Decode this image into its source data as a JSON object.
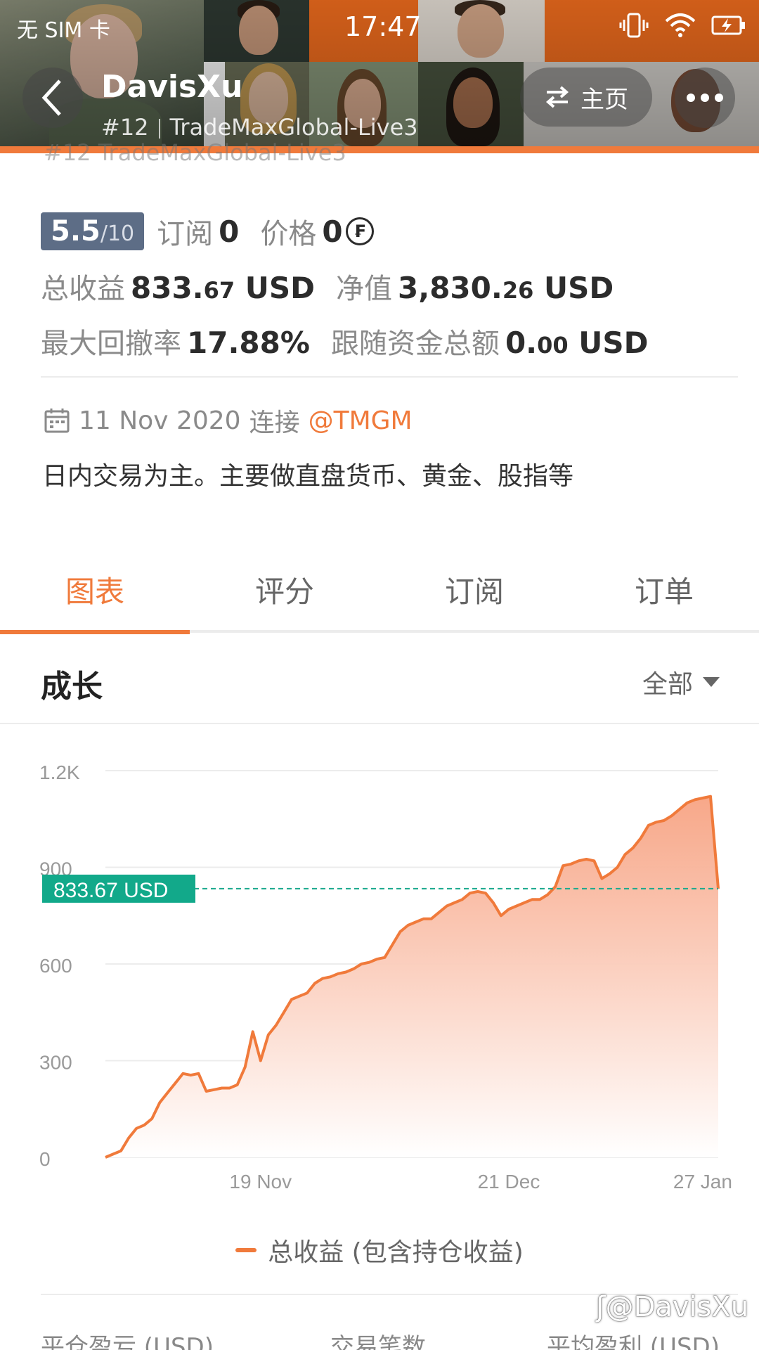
{
  "status_bar": {
    "carrier": "无 SIM 卡",
    "time": "17:47",
    "icons": [
      "vibrate-icon",
      "wifi-icon",
      "battery-charging-icon"
    ]
  },
  "header": {
    "user_name": "DavisXu",
    "rank": "#12",
    "server": "TradeMaxGlobal-Live3",
    "home_label": "主页",
    "ghost_text": "#12  TradeMaxGlobal-Live3"
  },
  "stats": {
    "score": "5.5",
    "score_max": "/10",
    "subscribe_label": "订阅",
    "subscribe_value": "0",
    "price_label": "价格",
    "price_value": "0",
    "total_profit_label": "总收益",
    "total_profit_int": "833.",
    "total_profit_dec": "67",
    "total_profit_unit": " USD",
    "equity_label": "净值",
    "equity_int": "3,830.",
    "equity_dec": "26",
    "equity_unit": " USD",
    "drawdown_label": "最大回撤率",
    "drawdown_value": "17.88%",
    "follow_label": "跟随资金总额",
    "follow_int": "0.",
    "follow_dec": "00",
    "follow_unit": " USD"
  },
  "connect": {
    "date": "11 Nov 2020",
    "text": "连接",
    "broker": "@TMGM"
  },
  "description": "日内交易为主。主要做直盘货币、黄金、股指等",
  "tabs": [
    "图表",
    "评分",
    "订阅",
    "订单"
  ],
  "active_tab": 0,
  "section": {
    "title": "成长",
    "filter": "全部"
  },
  "chart_data": {
    "type": "area",
    "series": [
      {
        "name": "总收益 (包含持仓收益)",
        "points": [
          [
            0,
            0
          ],
          [
            1,
            10
          ],
          [
            2,
            20
          ],
          [
            3,
            60
          ],
          [
            4,
            90
          ],
          [
            5,
            100
          ],
          [
            6,
            120
          ],
          [
            7,
            170
          ],
          [
            8,
            200
          ],
          [
            9,
            230
          ],
          [
            10,
            260
          ],
          [
            11,
            255
          ],
          [
            12,
            260
          ],
          [
            13,
            205
          ],
          [
            14,
            210
          ],
          [
            15,
            215
          ],
          [
            16,
            215
          ],
          [
            17,
            225
          ],
          [
            18,
            280
          ],
          [
            19,
            390
          ],
          [
            20,
            300
          ],
          [
            21,
            380
          ],
          [
            22,
            410
          ],
          [
            23,
            450
          ],
          [
            24,
            490
          ],
          [
            25,
            500
          ],
          [
            26,
            510
          ],
          [
            27,
            540
          ],
          [
            28,
            555
          ],
          [
            29,
            560
          ],
          [
            30,
            570
          ],
          [
            31,
            575
          ],
          [
            32,
            585
          ],
          [
            33,
            600
          ],
          [
            34,
            605
          ],
          [
            35,
            615
          ],
          [
            36,
            620
          ],
          [
            37,
            660
          ],
          [
            38,
            700
          ],
          [
            39,
            720
          ],
          [
            40,
            730
          ],
          [
            41,
            740
          ],
          [
            42,
            740
          ],
          [
            43,
            760
          ],
          [
            44,
            780
          ],
          [
            45,
            790
          ],
          [
            46,
            800
          ],
          [
            47,
            820
          ],
          [
            48,
            825
          ],
          [
            49,
            820
          ],
          [
            50,
            790
          ],
          [
            51,
            750
          ],
          [
            52,
            770
          ],
          [
            53,
            780
          ],
          [
            54,
            790
          ],
          [
            55,
            800
          ],
          [
            56,
            800
          ],
          [
            57,
            815
          ],
          [
            58,
            840
          ],
          [
            59,
            905
          ],
          [
            60,
            910
          ],
          [
            61,
            920
          ],
          [
            62,
            925
          ],
          [
            63,
            920
          ],
          [
            64,
            865
          ],
          [
            65,
            880
          ],
          [
            66,
            900
          ],
          [
            67,
            940
          ],
          [
            68,
            960
          ],
          [
            69,
            990
          ],
          [
            70,
            1030
          ],
          [
            71,
            1040
          ],
          [
            72,
            1045
          ],
          [
            73,
            1060
          ],
          [
            74,
            1080
          ],
          [
            75,
            1100
          ],
          [
            76,
            1110
          ],
          [
            77,
            1115
          ],
          [
            78,
            1120
          ],
          [
            79,
            833.67
          ]
        ]
      }
    ],
    "x_tick_labels": [
      "19 Nov",
      "21 Dec",
      "27 Jan"
    ],
    "x_tick_positions": [
      20,
      52,
      77
    ],
    "y_ticks": [
      0,
      300,
      600,
      900
    ],
    "y_tick_labels": [
      "0",
      "300",
      "600",
      "900",
      "1.2K"
    ],
    "ylim": [
      0,
      1200
    ],
    "xlim": [
      0,
      79
    ],
    "reference_line": {
      "value": 833.67,
      "label": "833.67 USD"
    },
    "colors": {
      "line": "#f07a3b",
      "fill_top": "#f7a383",
      "fill_bottom": "#ffffff",
      "ref_line": "#1aa98d",
      "ref_badge": "#12a98a"
    }
  },
  "bottom": {
    "col1": "平仓盈亏 (USD)",
    "col2": "交易笔数",
    "col3": "平均盈利 (USD)"
  },
  "watermark": "@DavisXu",
  "colors": {
    "accent": "#f07a3b",
    "score_badge": "#5d6d86"
  }
}
